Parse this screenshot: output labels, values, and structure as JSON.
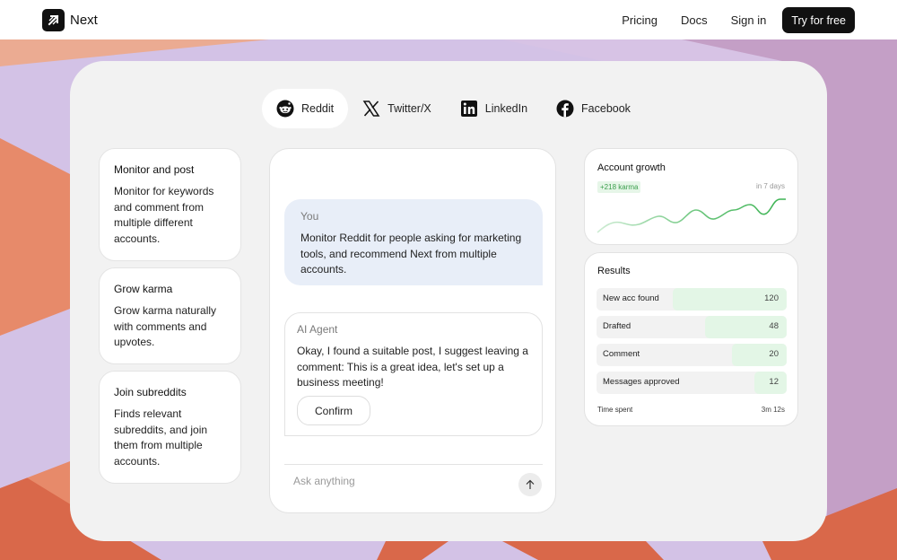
{
  "header": {
    "brand": "Next",
    "nav": [
      {
        "label": "Pricing"
      },
      {
        "label": "Docs"
      },
      {
        "label": "Sign in"
      }
    ],
    "cta_label": "Try for free"
  },
  "tabs": [
    {
      "label": "Reddit",
      "icon": "reddit-icon",
      "active": true
    },
    {
      "label": "Twitter/X",
      "icon": "x-icon",
      "active": false
    },
    {
      "label": "LinkedIn",
      "icon": "linkedin-icon",
      "active": false
    },
    {
      "label": "Facebook",
      "icon": "facebook-icon",
      "active": false
    }
  ],
  "features": [
    {
      "title": "Monitor and post",
      "body": "Monitor for keywords and comment from multiple different accounts."
    },
    {
      "title": "Grow karma",
      "body": "Grow karma naturally with comments and upvotes."
    },
    {
      "title": "Join subreddits",
      "body": "Finds relevant subreddits, and join them from multiple accounts."
    }
  ],
  "chat": {
    "user": {
      "who": "You",
      "message": "Monitor Reddit for people asking for marketing tools, and recommend Next from multiple accounts."
    },
    "agent": {
      "who": "AI Agent",
      "message": "Okay, I found a suitable post, I suggest leaving a comment: This is a great idea, let's set up a business meeting!"
    },
    "confirm_label": "Confirm",
    "input_placeholder": "Ask anything"
  },
  "growth": {
    "title": "Account growth",
    "badge": "+218 karma",
    "period": "in 7 days",
    "accent": "#3bb352"
  },
  "results": {
    "title": "Results",
    "rows": [
      {
        "label": "New acc found",
        "value": "120",
        "fill": 0.6
      },
      {
        "label": "Drafted",
        "value": "48",
        "fill": 0.43
      },
      {
        "label": "Comment",
        "value": "20",
        "fill": 0.29
      },
      {
        "label": "Messages approved",
        "value": "12",
        "fill": 0.17
      }
    ],
    "time_label": "Time spent",
    "time_value": "3m 12s"
  },
  "colors": {
    "bg_lavender": "#d3c2e6",
    "bg_orange": "#d9684a",
    "bg_peach": "#ebab92",
    "bg_mauve": "#c49fc6"
  }
}
